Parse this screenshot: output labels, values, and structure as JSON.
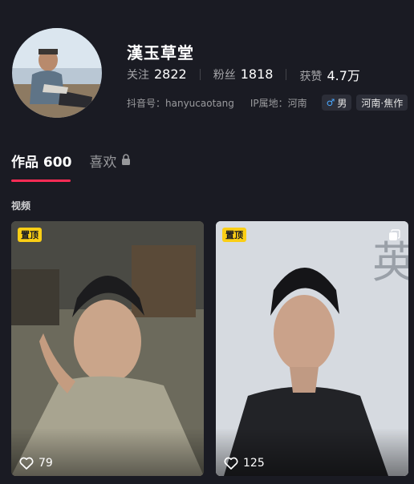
{
  "profile": {
    "name": "漢玉草堂",
    "stats": [
      {
        "label": "关注",
        "value": "2822"
      },
      {
        "label": "粉丝",
        "value": "1818"
      },
      {
        "label": "获赞",
        "value": "4.7万"
      }
    ],
    "douyin_id": "抖音号：hanyucaotang",
    "ip_location": "IP属地：河南",
    "gender_tag": "男",
    "region_tag": "河南·焦作"
  },
  "tabs": [
    {
      "label": "作品 600"
    },
    {
      "label": "喜欢"
    }
  ],
  "section_title": "视频",
  "videos": [
    {
      "pin_label": "置顶",
      "likes": "79"
    },
    {
      "pin_label": "置顶",
      "likes": "125",
      "watermark_text": "英雄"
    }
  ],
  "colors": {
    "background": "#1a1b23",
    "accent": "#fe2c55",
    "pin_badge": "#face15",
    "male": "#4aa8ff"
  }
}
